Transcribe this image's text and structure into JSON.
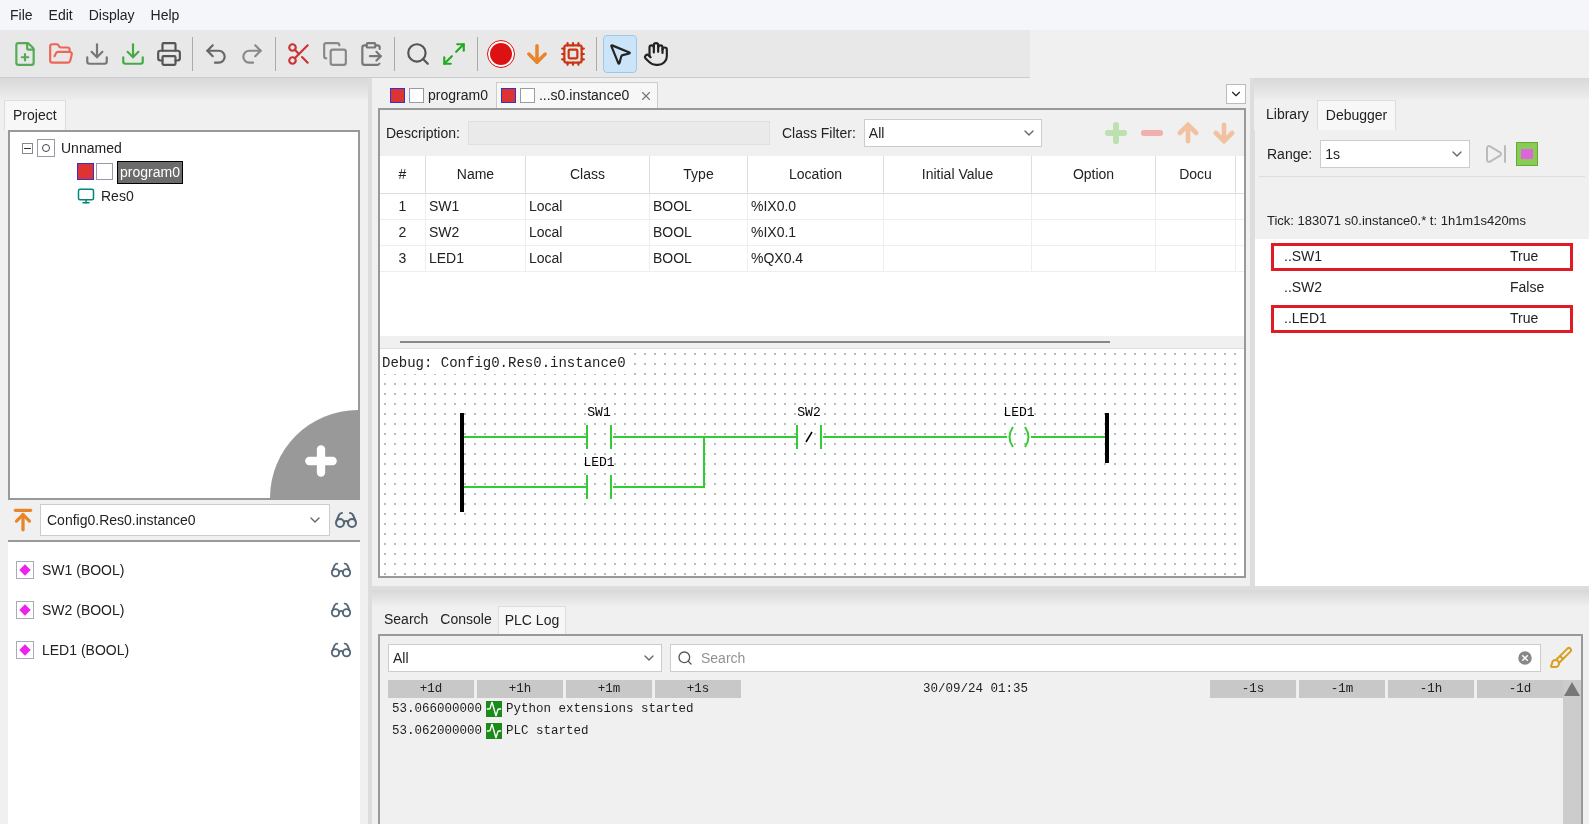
{
  "menu": [
    "File",
    "Edit",
    "Display",
    "Help"
  ],
  "project": {
    "tab": "Project",
    "tree": [
      {
        "label": "Unnamed",
        "kind": "project",
        "expanded": true,
        "selected": false,
        "children": [
          {
            "label": "program0",
            "kind": "program",
            "selected": true
          },
          {
            "label": "Res0",
            "kind": "resource",
            "selected": false
          }
        ]
      }
    ]
  },
  "instance": {
    "value": "Config0.Res0.instance0"
  },
  "variables": [
    {
      "label": "SW1 (BOOL)"
    },
    {
      "label": "SW2 (BOOL)"
    },
    {
      "label": "LED1 (BOOL)"
    }
  ],
  "editor_tabs": [
    {
      "label": "program0",
      "selected": false,
      "closable": false
    },
    {
      "label": "...s0.instance0",
      "selected": true,
      "closable": true
    }
  ],
  "description": {
    "label": "Description:"
  },
  "class_filter": {
    "label": "Class Filter:",
    "value": "All"
  },
  "table": {
    "columns": [
      "#",
      "Name",
      "Class",
      "Type",
      "Location",
      "Initial Value",
      "Option",
      "Docu"
    ],
    "rows": [
      [
        "1",
        "SW1",
        "Local",
        "BOOL",
        "%IX0.0",
        "",
        "",
        ""
      ],
      [
        "2",
        "SW2",
        "Local",
        "BOOL",
        "%IX0.1",
        "",
        "",
        ""
      ],
      [
        "3",
        "LED1",
        "Local",
        "BOOL",
        "%QX0.4",
        "",
        "",
        ""
      ]
    ]
  },
  "debug": {
    "title": "Debug: Config0.Res0.instance0",
    "elements": [
      {
        "kind": "contact",
        "label": "SW1"
      },
      {
        "kind": "contact",
        "label": "LED1"
      },
      {
        "kind": "negated_contact",
        "label": "SW2"
      },
      {
        "kind": "coil",
        "label": "LED1"
      }
    ]
  },
  "side_tabs": [
    {
      "label": "Library",
      "selected": false
    },
    {
      "label": "Debugger",
      "selected": true
    }
  ],
  "range": {
    "label": "Range:",
    "value": "1s"
  },
  "tick": "Tick: 183071  s0.instance0.*  t: 1h1m1s420ms",
  "debug_values": [
    {
      "name": "..SW1",
      "value": "True",
      "highlighted": true
    },
    {
      "name": "..SW2",
      "value": "False",
      "highlighted": false
    },
    {
      "name": "..LED1",
      "value": "True",
      "highlighted": true
    }
  ],
  "bottom_tabs": [
    {
      "label": "Search",
      "selected": false
    },
    {
      "label": "Console",
      "selected": false
    },
    {
      "label": "PLC Log",
      "selected": true
    }
  ],
  "log_filter": "All",
  "log_search": {
    "placeholder": "Search"
  },
  "log_forward": [
    "+1d",
    "+1h",
    "+1m",
    "+1s"
  ],
  "log_date": "30/09/24 01:35",
  "log_back": [
    "-1s",
    "-1m",
    "-1h",
    "-1d"
  ],
  "log": [
    {
      "time": "53.066000000",
      "message": "Python extensions started"
    },
    {
      "time": "53.062000000",
      "message": "PLC started"
    }
  ]
}
